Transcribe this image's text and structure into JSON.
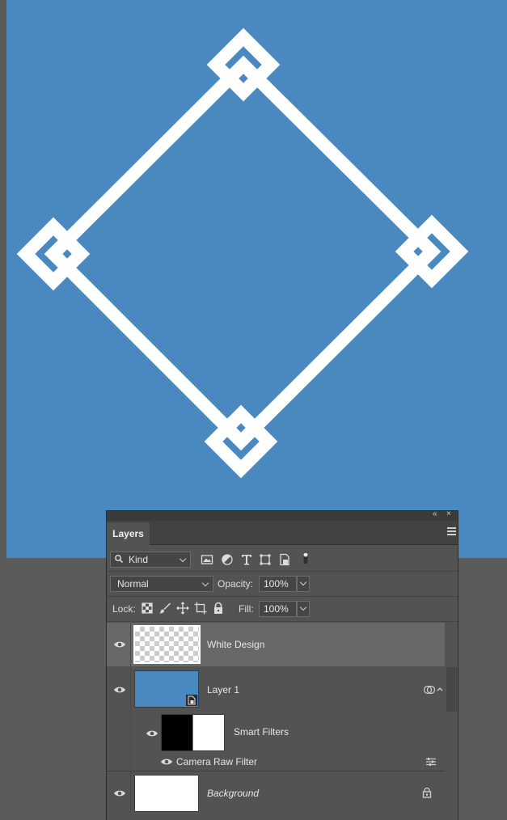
{
  "panel": {
    "collapse_label": "«",
    "close_label": "×",
    "tab_label": "Layers"
  },
  "filter": {
    "kind_label": "Kind"
  },
  "blend": {
    "mode": "Normal",
    "opacity_label": "Opacity:",
    "opacity_value": "100%"
  },
  "lock": {
    "label": "Lock:",
    "fill_label": "Fill:",
    "fill_value": "100%"
  },
  "layers": [
    {
      "name": "White Design",
      "selected": true
    },
    {
      "name": "Layer 1",
      "selected": false
    },
    {
      "name": "Smart Filters",
      "selected": false
    },
    {
      "name": "Camera Raw Filter",
      "selected": false
    },
    {
      "name": "Background",
      "selected": false
    }
  ],
  "colors": {
    "canvas_blue": "#4a89bf",
    "design_white": "#ffffff",
    "panel_bg": "#535353",
    "selected_row": "#686868"
  }
}
